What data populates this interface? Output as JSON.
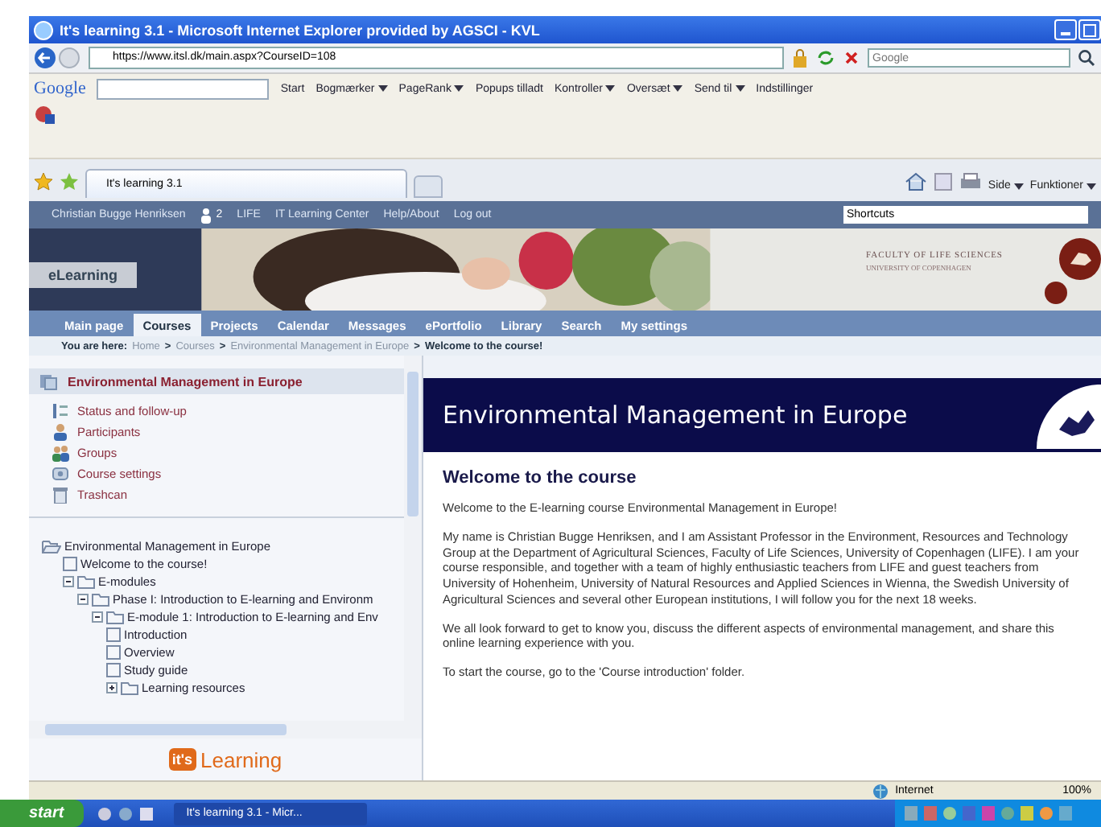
{
  "window": {
    "title": "It's learning 3.1 - Microsoft Internet Explorer provided by AGSCI - KVL"
  },
  "address_bar": {
    "url": "https://www.itsl.dk/main.aspx?CourseID=108",
    "search_placeholder": "Google"
  },
  "google_toolbar": {
    "logo": "Google",
    "items": [
      {
        "label": "Start",
        "dropdown": false
      },
      {
        "label": "Bogmærker",
        "dropdown": true
      },
      {
        "label": "PageRank",
        "dropdown": true
      },
      {
        "label": "Popups tilladt",
        "dropdown": false
      },
      {
        "label": "Kontroller",
        "dropdown": true
      },
      {
        "label": "Oversæt",
        "dropdown": true
      },
      {
        "label": "Send til",
        "dropdown": true
      },
      {
        "label": "Indstillinger",
        "dropdown": false
      }
    ]
  },
  "browser_tabs": [
    {
      "label": "It's learning 3.1",
      "selected": true
    }
  ],
  "command_bar": [
    "Side",
    "Funktioner"
  ],
  "site_bar": {
    "user": "Christian Bugge Henriksen",
    "online_count": "2",
    "links": [
      "LIFE",
      "IT Learning Center",
      "Help/About",
      "Log out"
    ],
    "shortcuts": "Shortcuts"
  },
  "banner": {
    "label": "eLearning",
    "faculty": "FACULTY OF LIFE SCIENCES",
    "university": "UNIVERSITY OF COPENHAGEN"
  },
  "nav": [
    {
      "label": "Main page",
      "selected": false
    },
    {
      "label": "Courses",
      "selected": true
    },
    {
      "label": "Projects",
      "selected": false
    },
    {
      "label": "Calendar",
      "selected": false
    },
    {
      "label": "Messages",
      "selected": false
    },
    {
      "label": "ePortfolio",
      "selected": false
    },
    {
      "label": "Library",
      "selected": false
    },
    {
      "label": "Search",
      "selected": false
    },
    {
      "label": "My settings",
      "selected": false
    }
  ],
  "breadcrumb": {
    "label": "You are here:",
    "separator": ">",
    "items": [
      "Home",
      "Courses",
      "Environmental Management in Europe",
      "Welcome to the course!"
    ]
  },
  "course_menu": {
    "title": "Environmental Management in Europe",
    "items": [
      {
        "label": "Status and follow-up",
        "kind": "status"
      },
      {
        "label": "Participants",
        "kind": "person"
      },
      {
        "label": "Groups",
        "kind": "group"
      },
      {
        "label": "Course settings",
        "kind": "settings"
      },
      {
        "label": "Trashcan",
        "kind": "trash"
      }
    ]
  },
  "tree": [
    {
      "label": "Environmental Management in Europe",
      "kind": "root",
      "children": [
        {
          "label": "Welcome to the course!",
          "kind": "page"
        },
        {
          "label": "E-modules",
          "kind": "folder",
          "expanded": true,
          "children": [
            {
              "label": "Phase I: Introduction to E-learning and Environm",
              "kind": "folder",
              "expanded": true,
              "children": [
                {
                  "label": "E-module 1: Introduction to E-learning and Env",
                  "kind": "folder",
                  "expanded": true,
                  "children": [
                    {
                      "label": "Introduction",
                      "kind": "page"
                    },
                    {
                      "label": "Overview",
                      "kind": "page"
                    },
                    {
                      "label": "Study guide",
                      "kind": "page"
                    },
                    {
                      "label": "Learning resources",
                      "kind": "folder",
                      "expanded": false
                    }
                  ]
                }
              ]
            }
          ]
        }
      ]
    }
  ],
  "footer_logo": {
    "badge": "it's",
    "word": "Learning"
  },
  "content": {
    "banner_title": "Environmental Management in Europe",
    "heading": "Welcome to the course",
    "paragraphs": [
      "Welcome to the E-learning course Environmental Management in Europe!",
      "My name is Christian Bugge Henriksen, and I am Assistant Professor in the Environment, Resources and Technology Group at the Department of Agricultural Sciences, Faculty of Life Sciences, University of Copenhagen (LIFE). I am your course responsible, and together with a team of highly enthusiastic teachers from LIFE and guest teachers from University of Hohenheim, University of Natural Resources and Applied Sciences in Wienna, the Swedish University of Agricultural Sciences and several other European institutions, I will follow you for the next 18 weeks.",
      "We all look forward to get to know you, discuss the different aspects of environmental management, and share this online learning experience with you.",
      "To start the course, go to the 'Course introduction' folder."
    ]
  },
  "status_bar": {
    "zone": "Internet",
    "zoom": "100%"
  },
  "taskbar": {
    "start": "start",
    "tasks": [
      {
        "label": "It's learning 3.1 - Micr...",
        "selected": true
      }
    ]
  }
}
